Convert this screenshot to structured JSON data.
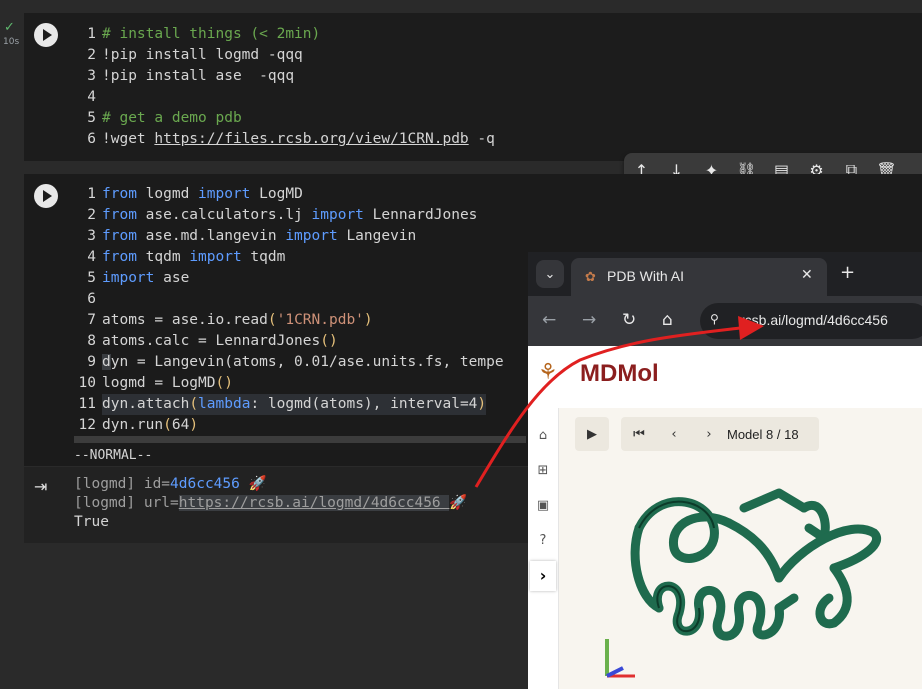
{
  "cell1": {
    "status_check": "✓",
    "exec_time": "10s",
    "lines": [
      {
        "n": "1",
        "parts": [
          {
            "t": "# install things (< 2min)",
            "c": "cmt"
          }
        ]
      },
      {
        "n": "2",
        "parts": [
          {
            "t": "!pip install logmd -qqq",
            "c": ""
          }
        ]
      },
      {
        "n": "3",
        "parts": [
          {
            "t": "!pip install ase  -qqq",
            "c": ""
          }
        ]
      },
      {
        "n": "4",
        "parts": [
          {
            "t": "",
            "c": ""
          }
        ]
      },
      {
        "n": "5",
        "parts": [
          {
            "t": "# get a demo pdb",
            "c": "cmt"
          }
        ]
      },
      {
        "n": "6",
        "parts": [
          {
            "t": "!wget ",
            "c": ""
          },
          {
            "t": "https://files.rcsb.org/view/1CRN.pdb",
            "c": "url"
          },
          {
            "t": " -q",
            "c": ""
          }
        ]
      }
    ]
  },
  "toolbar": {
    "icons": [
      "arrow-up-icon",
      "arrow-down-icon",
      "sparkle-icon",
      "link-icon",
      "comment-icon",
      "gear-icon",
      "mirror-cell-icon",
      "trash-icon"
    ],
    "glyphs": [
      "↑",
      "↓",
      "✦",
      "⛓",
      "▤",
      "⚙",
      "⧉",
      "🗑"
    ]
  },
  "cell2": {
    "lines": [
      {
        "n": "1",
        "parts": [
          {
            "t": "from",
            "c": "kw"
          },
          {
            "t": " logmd ",
            "c": ""
          },
          {
            "t": "import",
            "c": "kw"
          },
          {
            "t": " LogMD",
            "c": ""
          }
        ]
      },
      {
        "n": "2",
        "parts": [
          {
            "t": "from",
            "c": "kw"
          },
          {
            "t": " ase.calculators.lj ",
            "c": ""
          },
          {
            "t": "import",
            "c": "kw"
          },
          {
            "t": " LennardJones",
            "c": ""
          }
        ]
      },
      {
        "n": "3",
        "parts": [
          {
            "t": "from",
            "c": "kw"
          },
          {
            "t": " ase.md.langevin ",
            "c": ""
          },
          {
            "t": "import",
            "c": "kw"
          },
          {
            "t": " Langevin",
            "c": ""
          }
        ]
      },
      {
        "n": "4",
        "parts": [
          {
            "t": "from",
            "c": "kw"
          },
          {
            "t": " tqdm ",
            "c": ""
          },
          {
            "t": "import",
            "c": "kw"
          },
          {
            "t": " tqdm",
            "c": ""
          }
        ]
      },
      {
        "n": "5",
        "parts": [
          {
            "t": "import",
            "c": "kw"
          },
          {
            "t": " ase",
            "c": ""
          }
        ]
      },
      {
        "n": "6",
        "parts": [
          {
            "t": "",
            "c": ""
          }
        ]
      },
      {
        "n": "7",
        "parts": [
          {
            "t": "atoms = ase.io.read",
            "c": ""
          },
          {
            "t": "(",
            "c": "paren"
          },
          {
            "t": "'1CRN.pdb'",
            "c": "str"
          },
          {
            "t": ")",
            "c": "paren"
          }
        ]
      },
      {
        "n": "8",
        "parts": [
          {
            "t": "atoms.calc = LennardJones",
            "c": ""
          },
          {
            "t": "()",
            "c": "paren"
          }
        ]
      },
      {
        "n": "9",
        "parts": [
          {
            "t": "d",
            "c": "hl"
          },
          {
            "t": "yn = Langevin(atoms, 0.01/ase.units.fs, tempe",
            "c": ""
          }
        ]
      },
      {
        "n": "10",
        "parts": [
          {
            "t": "logmd = LogMD",
            "c": ""
          },
          {
            "t": "()",
            "c": "paren"
          }
        ]
      },
      {
        "n": "11",
        "parts": [
          {
            "t": "dyn.attach",
            "c": ""
          },
          {
            "t": "(",
            "c": "paren"
          },
          {
            "t": "lambda",
            "c": "lam"
          },
          {
            "t": ": logmd(atoms), interval=4",
            "c": ""
          },
          {
            "t": ")",
            "c": "paren"
          }
        ]
      },
      {
        "n": "12",
        "parts": [
          {
            "t": "dyn.run",
            "c": ""
          },
          {
            "t": "(",
            "c": "paren"
          },
          {
            "t": "64",
            "c": ""
          },
          {
            "t": ")",
            "c": "paren"
          }
        ]
      }
    ],
    "mode": "--NORMAL--"
  },
  "output": {
    "line1_prefix": "[logmd] id=",
    "line1_id": "4d6cc456",
    "line1_emoji": " 🚀",
    "line2_prefix": "[logmd] url=",
    "line2_url": "https://rcsb.ai/logmd/4d6cc456 ",
    "line2_emoji": "🚀",
    "line3": "True"
  },
  "browser": {
    "tab_title": "PDB With AI",
    "url": "rcsb.ai/logmd/4d6cc456",
    "brand": "MDMol",
    "model_label": "Model 8 / 18"
  },
  "colors": {
    "protein": "#1f6b4e",
    "arrow": "#e02020",
    "brand": "#8b1e1e"
  }
}
